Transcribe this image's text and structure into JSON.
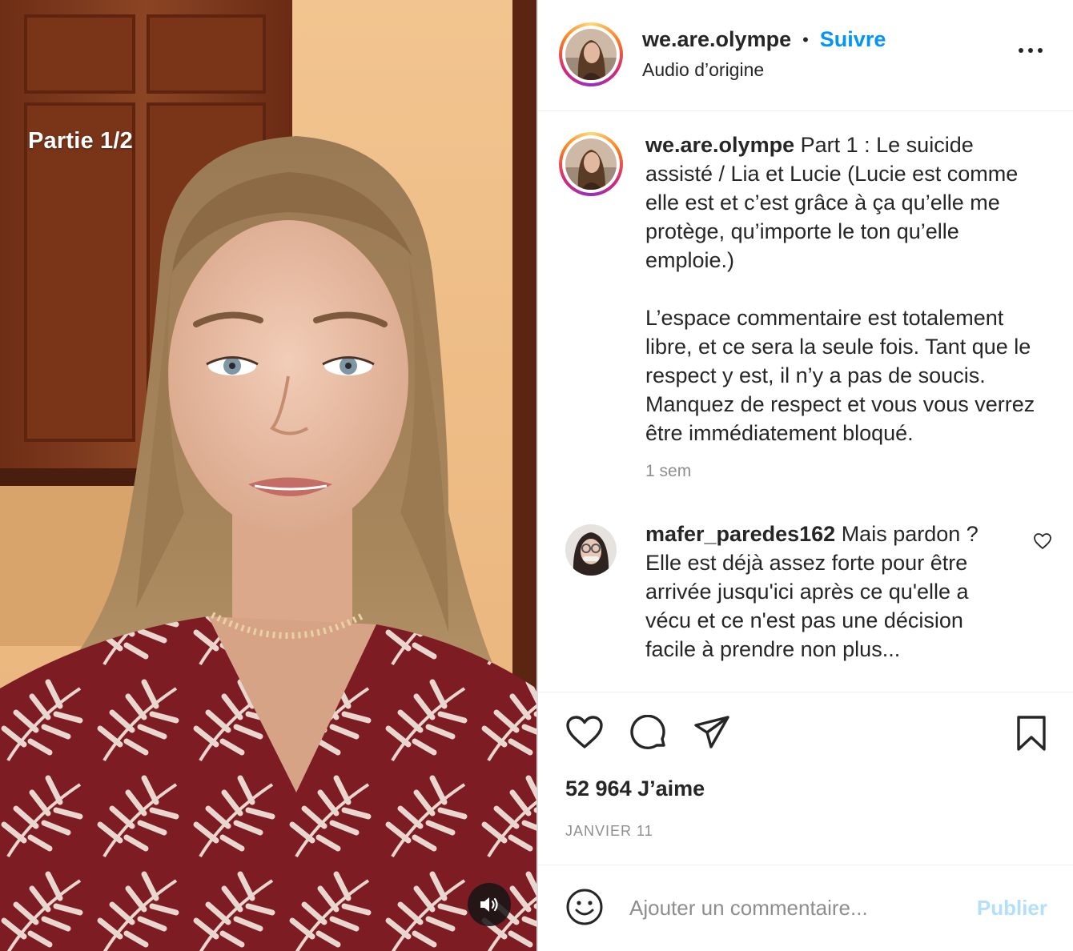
{
  "media": {
    "overlay_text": "Partie 1/2",
    "sound_icon": "speaker-icon"
  },
  "header": {
    "username": "we.are.olympe",
    "separator": "•",
    "follow_label": "Suivre",
    "audio_label": "Audio d’origine",
    "more_icon": "more-horizontal-icon"
  },
  "caption": {
    "username": "we.are.olympe",
    "paragraph1": "Part 1 : Le suicide assisté / Lia et Lucie (Lucie est comme elle est et c’est grâce à ça qu’elle me protège, qu’importe le ton qu’elle emploie.)",
    "paragraph2": "L’espace commentaire est totalement libre, et ce sera la seule fois. Tant que le respect y est, il n’y a pas de soucis. Manquez de respect et vous vous verrez être immédiatement bloqué.",
    "time": "1 sem"
  },
  "comments": [
    {
      "username": "mafer_paredes162",
      "text": "Mais pardon ? Elle est déjà assez forte pour être arrivée jusqu'ici après ce qu'elle a vécu et ce n'est pas une décision facile à prendre non plus..."
    }
  ],
  "actions": {
    "icons": [
      "heart-icon",
      "comment-icon",
      "share-icon",
      "bookmark-icon"
    ]
  },
  "stats": {
    "likes": "52 964 J’aime",
    "date": "JANVIER 11"
  },
  "add_comment": {
    "placeholder": "Ajouter un commentaire...",
    "publish_label": "Publier"
  },
  "colors": {
    "accent": "#0095f6",
    "publish_disabled": "#b2dffc",
    "text": "#262626",
    "muted": "#8e8e8e"
  }
}
